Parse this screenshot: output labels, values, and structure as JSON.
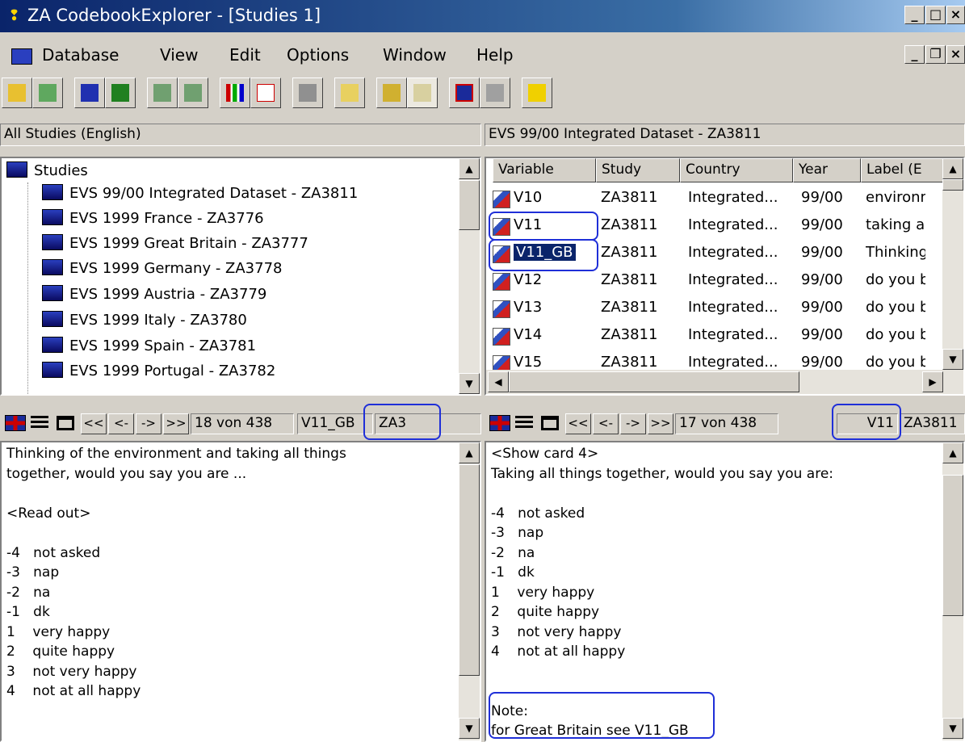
{
  "window": {
    "title": "ZA CodebookExplorer - [Studies 1]"
  },
  "menu": [
    "Database",
    "View",
    "Edit",
    "Options",
    "Window",
    "Help"
  ],
  "toolbar_icons": [
    "open-folder-icon",
    "open-document-icon",
    "blue-folder-icon",
    "green-folder-icon",
    "document-a-icon",
    "document-b-icon",
    "bar-chart-icon",
    "pdf-icon",
    "print-icon",
    "search-icon",
    "book-icon",
    "columns-icon",
    "uk-flag-icon",
    "wrench-icon",
    "help-icon"
  ],
  "left_pane": {
    "header": "All Studies (English)",
    "tree_root": "Studies",
    "items": [
      "EVS 99/00  Integrated Dataset  - ZA3811",
      "EVS 1999  France  - ZA3776",
      "EVS 1999  Great Britain  - ZA3777",
      "EVS 1999  Germany  - ZA3778",
      "EVS 1999  Austria  - ZA3779",
      "EVS 1999  Italy  - ZA3780",
      "EVS 1999  Spain  - ZA3781",
      "EVS 1999  Portugal  - ZA3782"
    ]
  },
  "right_pane": {
    "header": "EVS 99/00  Integrated Dataset  - ZA3811",
    "columns": [
      "Variable",
      "Study",
      "Country",
      "Year",
      "Label (E"
    ],
    "rows": [
      [
        "V10",
        "ZA3811",
        "Integrated...",
        "99/00",
        "environm"
      ],
      [
        "V11",
        "ZA3811",
        "Integrated...",
        "99/00",
        "taking al"
      ],
      [
        "V11_GB",
        "ZA3811",
        "Integrated...",
        "99/00",
        "Thinking"
      ],
      [
        "V12",
        "ZA3811",
        "Integrated...",
        "99/00",
        "do you b"
      ],
      [
        "V13",
        "ZA3811",
        "Integrated...",
        "99/00",
        "do you b"
      ],
      [
        "V14",
        "ZA3811",
        "Integrated...",
        "99/00",
        "do you b"
      ],
      [
        "V15",
        "ZA3811",
        "Integrated...",
        "99/00",
        "do you b"
      ]
    ]
  },
  "left_nav": {
    "first": "<<",
    "prev": "<-",
    "next": "->",
    "last": ">>",
    "position": "18 von 438",
    "variable": "V11_GB",
    "study": "ZA3"
  },
  "right_nav": {
    "first": "<<",
    "prev": "<-",
    "next": "->",
    "last": ">>",
    "position": "17 von 438",
    "variable": "V11",
    "study": "ZA3811"
  },
  "left_text": [
    "Thinking of the environment and taking all things",
    "together, would you say you are ...",
    "",
    "<Read out>",
    "",
    "-4   not asked",
    "-3   nap",
    "-2   na",
    "-1   dk",
    "1    very happy",
    "2    quite happy",
    "3    not very happy",
    "4    not at all happy"
  ],
  "right_text": [
    "<Show card 4>",
    "Taking all things together, would you say you are:",
    "",
    "-4   not asked",
    "-3   nap",
    "-2   na",
    "-1   dk",
    "1    very happy",
    "2    quite happy",
    "3    not very happy",
    "4    not at all happy",
    "",
    "",
    "Note:",
    "for Great Britain see V11_GB"
  ]
}
